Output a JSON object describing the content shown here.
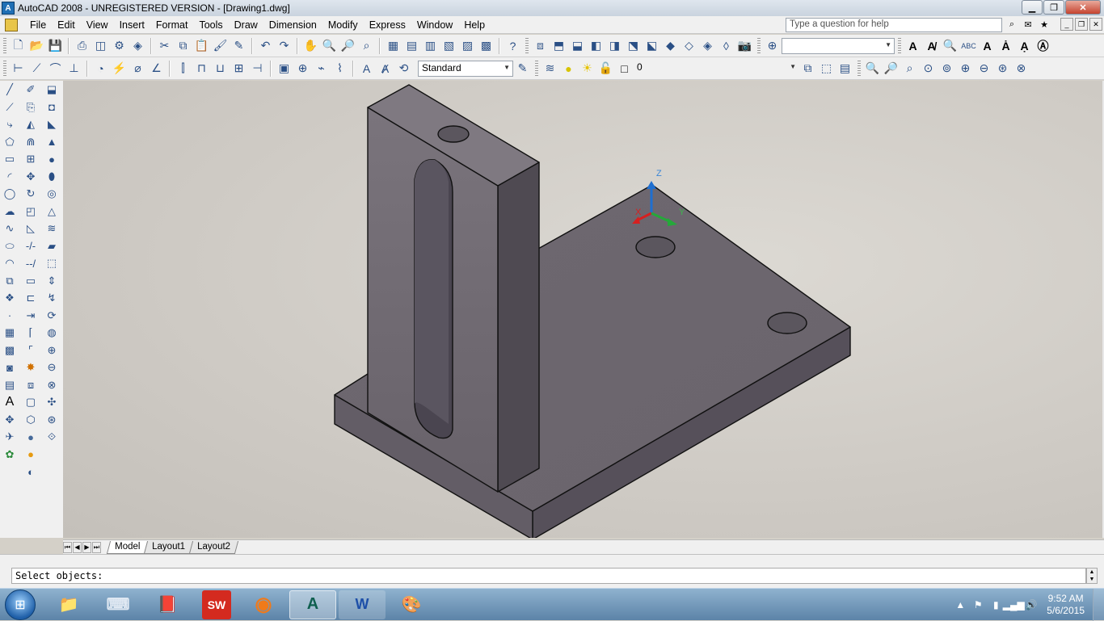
{
  "window": {
    "title": "AutoCAD 2008 - UNREGISTERED VERSION - [Drawing1.dwg]",
    "app_icon_text": "A"
  },
  "menubar": {
    "items": [
      "File",
      "Edit",
      "View",
      "Insert",
      "Format",
      "Tools",
      "Draw",
      "Dimension",
      "Modify",
      "Express",
      "Window",
      "Help"
    ],
    "help_placeholder": "Type a question for help"
  },
  "toolbar2": {
    "text_style": "Standard",
    "layer": "0"
  },
  "ucs_icon": {
    "z_label": "Z",
    "y_label": "Y",
    "x_label": "X"
  },
  "layout_tabs": {
    "model": "Model",
    "layout1": "Layout1",
    "layout2": "Layout2"
  },
  "command": {
    "text": "Select objects:"
  },
  "taskbar": {
    "apps": [
      {
        "name": "file-explorer",
        "label": "📁"
      },
      {
        "name": "keyboard",
        "label": "⌨"
      },
      {
        "name": "book",
        "label": "📕"
      },
      {
        "name": "solidworks",
        "label": "SW"
      },
      {
        "name": "firefox",
        "label": "◉"
      },
      {
        "name": "autocad",
        "label": "A"
      },
      {
        "name": "word",
        "label": "W"
      },
      {
        "name": "paint",
        "label": "🎨"
      }
    ],
    "time": "9:52 AM",
    "date": "5/6/2015"
  },
  "colors": {
    "solid_dark": "#4f4a52",
    "solid_mid": "#66616a",
    "solid_light": "#7a757d",
    "ucs_z": "#1f6fd0",
    "ucs_x": "#d62020",
    "ucs_y": "#25a83a"
  }
}
